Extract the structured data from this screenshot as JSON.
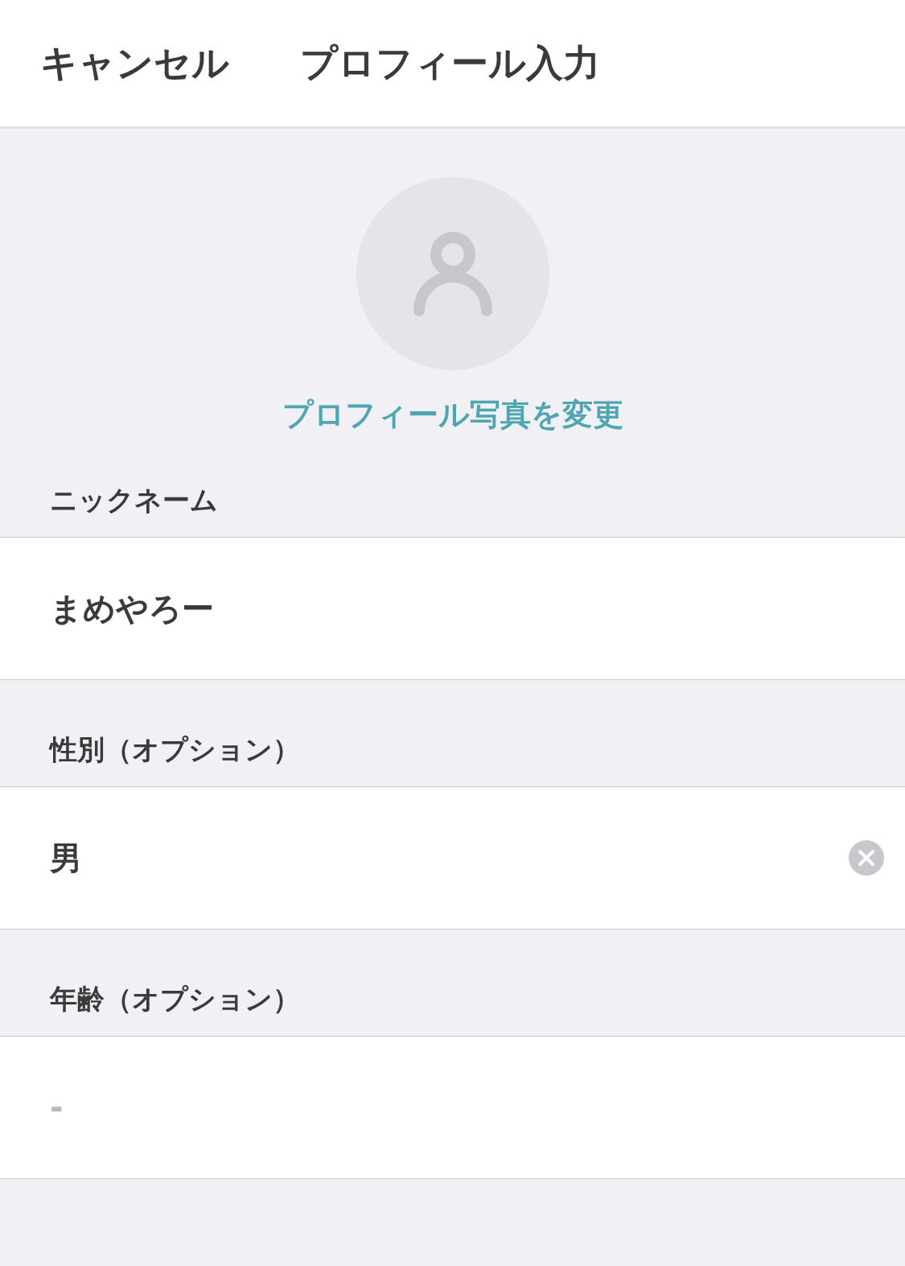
{
  "header": {
    "cancel": "キャンセル",
    "title": "プロフィール入力"
  },
  "avatar": {
    "change_link": "プロフィール写真を変更"
  },
  "fields": [
    {
      "label": "ニックネーム",
      "value": "まめやろー",
      "clearable": false
    },
    {
      "label": "性別（オプション）",
      "value": "男",
      "clearable": true
    },
    {
      "label": "年齢（オプション）",
      "placeholder": "-",
      "clearable": false
    }
  ]
}
